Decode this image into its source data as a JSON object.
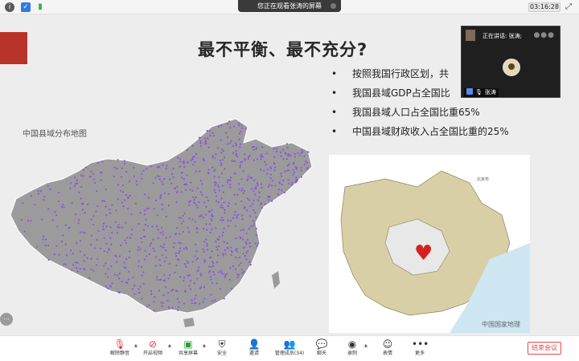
{
  "top_bar": {
    "sharing_banner": "您正在观看张涛的屏幕",
    "clock": "03:16:28",
    "icons": [
      "info-icon",
      "shield-icon",
      "signal-icon",
      "fullscreen-icon"
    ]
  },
  "slide": {
    "title": "最不平衡、最不充分?",
    "bullets": [
      "按照我国行政区划，共",
      "我国县域GDP占全国比",
      "我国县域人口占全国比重65%",
      "中国县域财政收入占全国比重的25%"
    ],
    "map_caption": "中国县域分布地图",
    "inset_caption": "中国国家地理",
    "inset_center_label": "北京市",
    "colors": {
      "accent_red": "#b8332a",
      "map_fill": "#9b9b9b",
      "dot_color": "#8a52e6"
    }
  },
  "video_tile": {
    "speaking_label": "正在讲话: 张涛;",
    "participant_name": "张涛"
  },
  "toolbar": {
    "items": [
      {
        "label": "解除静音",
        "icon": "mic-muted-icon"
      },
      {
        "label": "开启视频",
        "icon": "video-off-icon"
      },
      {
        "label": "共享屏幕",
        "icon": "share-screen-icon"
      },
      {
        "label": "安全",
        "icon": "shield-icon"
      },
      {
        "label": "邀请",
        "icon": "invite-icon"
      },
      {
        "label": "管理成员(34)",
        "icon": "members-icon"
      },
      {
        "label": "聊天",
        "icon": "chat-icon"
      },
      {
        "label": "录制",
        "icon": "record-icon"
      },
      {
        "label": "表情",
        "icon": "emoji-icon"
      },
      {
        "label": "更多",
        "icon": "more-icon"
      }
    ],
    "end_meeting": "结束会议"
  }
}
